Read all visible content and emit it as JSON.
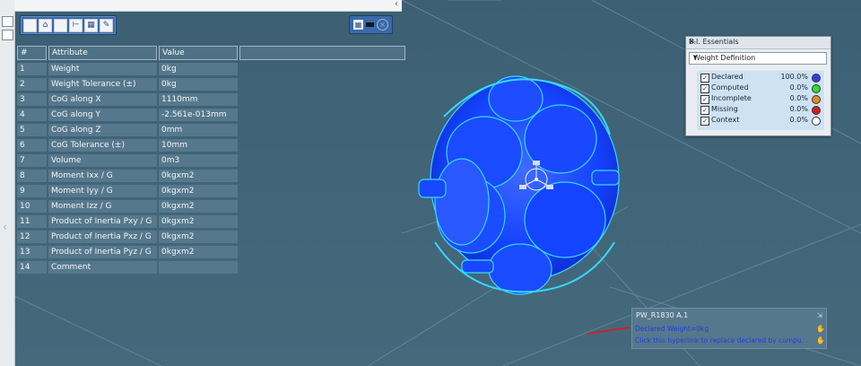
{
  "table": {
    "headers": [
      "#",
      "Attribute",
      "Value"
    ],
    "rows": [
      {
        "num": "1",
        "attr": "Weight",
        "val": "0kg"
      },
      {
        "num": "2",
        "attr": "Weight Tolerance (±)",
        "val": "0kg"
      },
      {
        "num": "3",
        "attr": "CoG along X",
        "val": "1110mm"
      },
      {
        "num": "4",
        "attr": "CoG along Y",
        "val": "-2.561e-013mm"
      },
      {
        "num": "5",
        "attr": "CoG along Z",
        "val": "0mm"
      },
      {
        "num": "6",
        "attr": "CoG Tolerance (±)",
        "val": "10mm"
      },
      {
        "num": "7",
        "attr": "Volume",
        "val": "0m3"
      },
      {
        "num": "8",
        "attr": "Moment Ixx / G",
        "val": "0kgxm2"
      },
      {
        "num": "9",
        "attr": "Moment Iyy / G",
        "val": "0kgxm2"
      },
      {
        "num": "10",
        "attr": "Moment Izz / G",
        "val": "0kgxm2"
      },
      {
        "num": "11",
        "attr": "Product of Inertia Pxy / G",
        "val": "0kgxm2"
      },
      {
        "num": "12",
        "attr": "Product of Inertia Pxz / G",
        "val": "0kgxm2"
      },
      {
        "num": "13",
        "attr": "Product of Inertia Pyz / G",
        "val": "0kgxm2"
      },
      {
        "num": "14",
        "attr": "Comment",
        "val": ""
      }
    ]
  },
  "bi_essentials": {
    "title": "B.I. Essentials",
    "dropdown_value": "Weight Definition",
    "items": [
      {
        "label": "Declared",
        "pct": "100.0%",
        "color": "#2f3fe0"
      },
      {
        "label": "Computed",
        "pct": "0.0%",
        "color": "#2ee02e"
      },
      {
        "label": "Incomplete",
        "pct": "0.0%",
        "color": "#e08a2a"
      },
      {
        "label": "Missing",
        "pct": "0.0%",
        "color": "#d21f1f"
      },
      {
        "label": "Context",
        "pct": "0.0%",
        "color": "#ffffff"
      }
    ]
  },
  "info_panel": {
    "title": "PW_R1830 A.1",
    "line1": "Declared Weight=0kg",
    "line2": "Click this hyperlink to replace declared by computed wei..."
  },
  "icons": {
    "toolbar": [
      "square-icon",
      "home-icon",
      "square-icon",
      "tree-icon",
      "table-icon",
      "tools-icon"
    ],
    "toolbar2": [
      "grid-icon",
      "minus-icon",
      "close-icon"
    ]
  },
  "colors": {
    "background": "#3f6276",
    "model": "#1446ff",
    "highlight": "#2ee0ff"
  }
}
